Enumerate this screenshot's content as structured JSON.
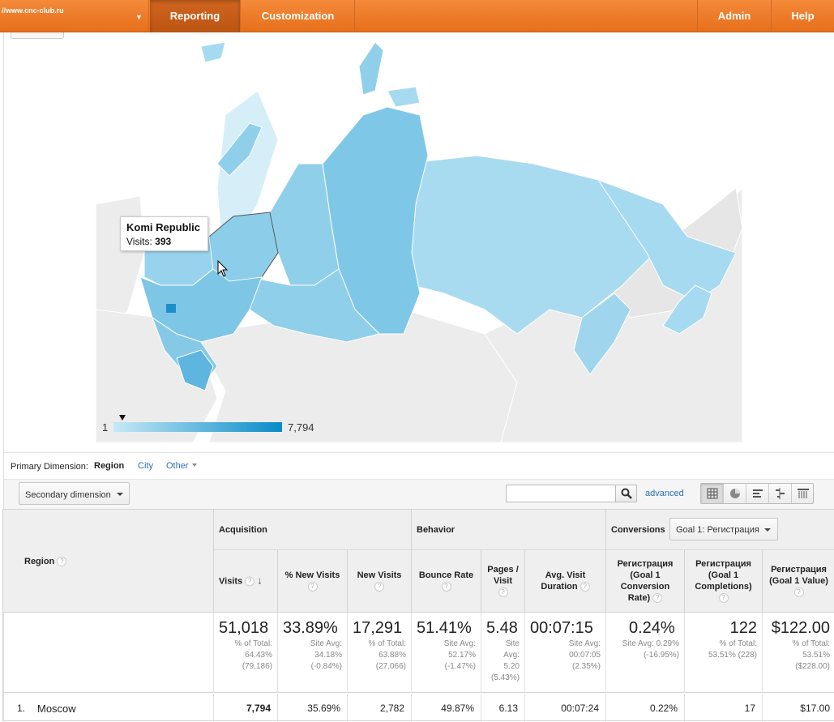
{
  "topbar": {
    "account_url": "//www.cnc-club.ru",
    "nav": {
      "reporting": "Reporting",
      "customization": "Customization",
      "admin": "Admin",
      "help": "Help"
    }
  },
  "map": {
    "tooltip": {
      "title": "Komi Republic",
      "metric_label": "Visits:",
      "metric_value": "393"
    },
    "legend": {
      "min": "1",
      "max": "7,794"
    },
    "colors": {
      "low": "#c6e9f6",
      "high": "#078bc8",
      "land": "#ededed"
    }
  },
  "dimensions": {
    "label": "Primary Dimension:",
    "active": "Region",
    "city": "City",
    "other": "Other"
  },
  "toolbar": {
    "secondary_dimension": "Secondary dimension",
    "search_placeholder": "",
    "advanced": "advanced"
  },
  "table": {
    "region_header": "Region",
    "groups": {
      "acquisition": "Acquisition",
      "behavior": "Behavior",
      "conversions": "Conversions"
    },
    "goal_select": "Goal 1: Регистрация",
    "columns": {
      "visits": "Visits",
      "pct_new_visits": "% New Visits",
      "new_visits": "New Visits",
      "bounce_rate": "Bounce Rate",
      "pages_visit": "Pages / Visit",
      "avg_visit_duration": "Avg. Visit Duration",
      "goal_conv_rate": "Регистрация (Goal 1 Conversion Rate)",
      "goal_completions": "Регистрация (Goal 1 Completions)",
      "goal_value": "Регистрация (Goal 1 Value)"
    },
    "totals": {
      "visits": {
        "value": "51,018",
        "l1": "% of Total:",
        "l2": "64.43%",
        "l3": "(79,186)"
      },
      "pct_new_visits": {
        "value": "33.89%",
        "l1": "Site Avg:",
        "l2": "34.18%",
        "l3": "(-0.84%)"
      },
      "new_visits": {
        "value": "17,291",
        "l1": "% of Total:",
        "l2": "63.88%",
        "l3": "(27,066)"
      },
      "bounce_rate": {
        "value": "51.41%",
        "l1": "Site Avg:",
        "l2": "52.17%",
        "l3": "(-1.47%)"
      },
      "pages_visit": {
        "value": "5.48",
        "l1": "Site",
        "l2": "Avg:",
        "l3": "5.20",
        "l4": "(5.43%)"
      },
      "avg_visit_duration": {
        "value": "00:07:15",
        "l1": "Site Avg:",
        "l2": "00:07:05",
        "l3": "(2.35%)"
      },
      "goal_conv_rate": {
        "value": "0.24%",
        "l1": "Site Avg: 0.29%",
        "l2": "(-16.95%)"
      },
      "goal_completions": {
        "value": "122",
        "l1": "% of Total:",
        "l2": "53.51% (228)"
      },
      "goal_value": {
        "value": "$122.00",
        "l1": "% of Total:",
        "l2": "53.51%",
        "l3": "($228.00)"
      }
    },
    "rows": [
      {
        "index": "1.",
        "region": "Moscow",
        "visits": "7,794",
        "pct_new_visits": "35.69%",
        "new_visits": "2,782",
        "bounce_rate": "49.87%",
        "pages_visit": "6.13",
        "avg_visit_duration": "00:07:24",
        "goal_conv_rate": "0.22%",
        "goal_completions": "17",
        "goal_value": "$17.00"
      }
    ]
  }
}
